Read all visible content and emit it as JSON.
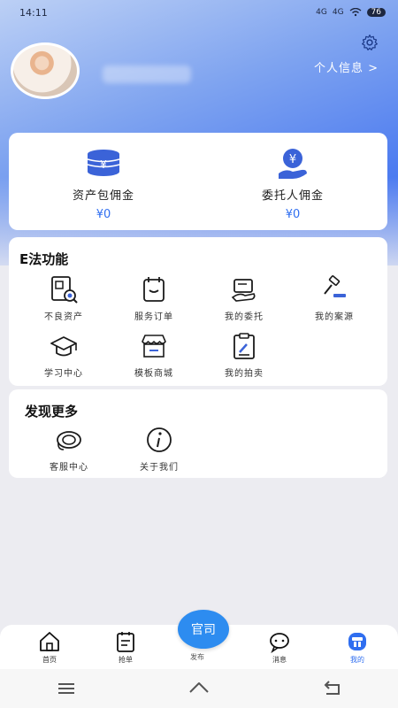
{
  "status_bar": {
    "time": "14:11",
    "signal_1": "4G",
    "signal_2": "4G",
    "battery": "76"
  },
  "profile": {
    "link_label": "个人信息 >"
  },
  "wallet": [
    {
      "label": "资产包佣金",
      "value": "¥0",
      "icon": "coin-stack-icon"
    },
    {
      "label": "委托人佣金",
      "value": "¥0",
      "icon": "yen-hand-icon"
    }
  ],
  "efa": {
    "title": "E法功能",
    "items": [
      {
        "label": "不良资产",
        "icon": "document-search-icon"
      },
      {
        "label": "服务订单",
        "icon": "order-calendar-icon"
      },
      {
        "label": "我的委托",
        "icon": "delegation-icon"
      },
      {
        "label": "我的案源",
        "icon": "gavel-icon"
      },
      {
        "label": "学习中心",
        "icon": "graduation-cap-icon"
      },
      {
        "label": "模板商城",
        "icon": "store-icon"
      },
      {
        "label": "我的拍卖",
        "icon": "auction-clipboard-icon"
      }
    ]
  },
  "more": {
    "title": "发现更多",
    "items": [
      {
        "label": "客服中心",
        "icon": "headset-icon"
      },
      {
        "label": "关于我们",
        "icon": "info-icon"
      }
    ]
  },
  "tabbar": {
    "items": [
      {
        "label": "首页",
        "icon": "home-icon"
      },
      {
        "label": "抢单",
        "icon": "order-list-icon"
      },
      {
        "label": "消息",
        "icon": "chat-bubble-icon"
      },
      {
        "label": "我的",
        "icon": "profile-icon"
      }
    ],
    "fab_label": "官司",
    "fab_caption": "发布"
  },
  "colors": {
    "accent": "#2f6ef0",
    "fab": "#2d8cf0"
  }
}
